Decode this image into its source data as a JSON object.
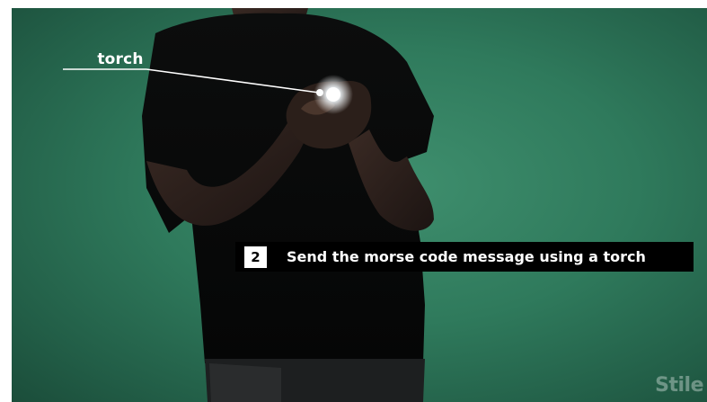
{
  "callout": {
    "label": "torch"
  },
  "step": {
    "number": "2",
    "text": "Send the morse code message using a torch"
  },
  "branding": {
    "watermark": "Stile"
  },
  "colors": {
    "background_green": "#2f7a5c",
    "banner": "#000000",
    "text": "#ffffff"
  }
}
